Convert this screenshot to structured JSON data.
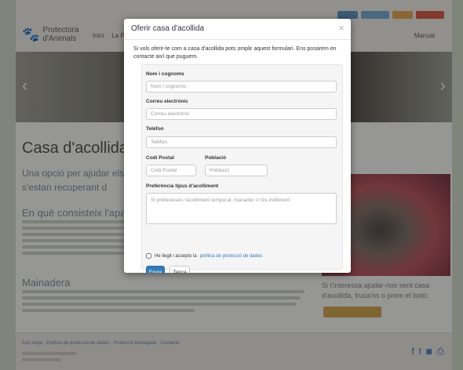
{
  "site": {
    "logo_line1": "Protectora",
    "logo_line2": "d'Animals",
    "nav_links": [
      "Inici",
      "La Pr"
    ],
    "nav_right": "Manual",
    "page_title": "Casa d'acollida",
    "intro_text": "Una opció per ajudar els nos mentre s'estan recuperant d",
    "section1_title": "En què consisteix l'apadr",
    "section2_title": "Mainadera",
    "side_text": "Si t'interessa ajudar-nos sent casa d'acollida, truca'ns o prem el botó:",
    "footer_links": "Avís legal · Política de protecció de dades · Protecció hostatjada · Contacte",
    "footer_sub": "Protectora d'animals",
    "colors": {
      "lang_btn_1": "#5b8fc0",
      "lang_btn_2": "#6fa7cf",
      "lang_btn_3": "#e2a24c",
      "lang_btn_4": "#d0573e",
      "accent_button": "#cda24a"
    }
  },
  "modal": {
    "title": "Oferir casa d'acollida",
    "close_symbol": "×",
    "intro": "Si vols oferir-te com a casa d'acollida pots omplir aquest formulari. Ens posarem en contacte així que puguem.",
    "fields": {
      "name": {
        "label": "Nom i cognoms",
        "placeholder": "Nom i cognoms"
      },
      "email": {
        "label": "Correu electrònic",
        "placeholder": "Correu electrònic"
      },
      "phone": {
        "label": "Telèfon",
        "placeholder": "Telèfon"
      },
      "postal": {
        "label": "Codi Postal",
        "placeholder": "Codi Postal"
      },
      "city": {
        "label": "Població",
        "placeholder": "Població"
      },
      "preference": {
        "label": "Preferència tipus d'acolliment",
        "placeholder": "Si preferesses l'acolliment temporal, manadar o t'és indiferent"
      }
    },
    "consent_prefix": "He llegit i accepto la",
    "consent_link": "política de protecció de dades",
    "submit_label": "Envia",
    "cancel_label": "Tanca",
    "colors": {
      "primary": "#337ab7"
    }
  }
}
